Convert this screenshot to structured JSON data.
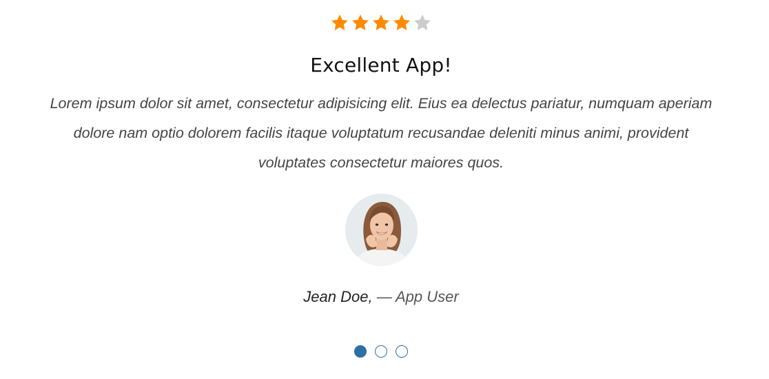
{
  "rating": {
    "value": 4,
    "max": 5,
    "filled_color": "#ff8a00",
    "empty_color": "#cccccc",
    "icon": "star-icon"
  },
  "testimonial": {
    "title": "Excellent App!",
    "quote": "Lorem ipsum dolor sit amet, consectetur adipisicing elit. Eius ea delectus pariatur, numquam aperiam dolore nam optio dolorem facilis itaque voluptatum recusandae deleniti minus animi, provident voluptates consectetur maiores quos.",
    "author_name": "Jean Doe,",
    "author_role": " — App User"
  },
  "pagination": {
    "count": 3,
    "active_index": 0,
    "color": "#2f6fa3"
  }
}
